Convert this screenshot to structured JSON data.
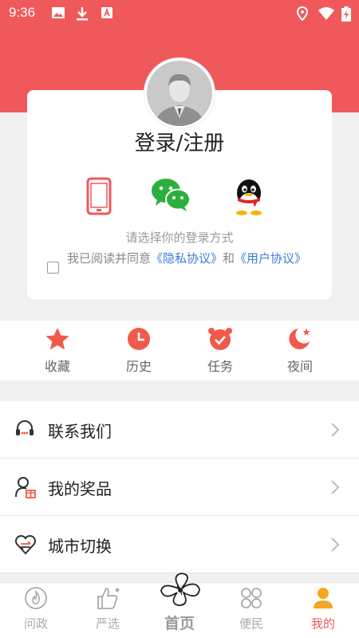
{
  "status_bar": {
    "time": "9:36"
  },
  "login": {
    "title": "登录/注册",
    "methods": [
      "phone-icon",
      "wechat-icon",
      "qq-icon"
    ],
    "tip": "请选择你的登录方式",
    "agree_prefix": "我已阅读并同意",
    "privacy_link": "《隐私协议》",
    "and": "和",
    "user_link": "《用户协议》"
  },
  "quick": [
    {
      "label": "收藏",
      "icon": "star-icon"
    },
    {
      "label": "历史",
      "icon": "clock-icon"
    },
    {
      "label": "任务",
      "icon": "alarm-icon"
    },
    {
      "label": "夜间",
      "icon": "moon-icon"
    }
  ],
  "menu": [
    {
      "label": "联系我们",
      "icon": "headset-icon"
    },
    {
      "label": "我的奖品",
      "icon": "gift-user-icon"
    },
    {
      "label": "城市切换",
      "icon": "city-switch-icon"
    }
  ],
  "tabs": [
    {
      "label": "问政"
    },
    {
      "label": "严选"
    },
    {
      "label": "首页"
    },
    {
      "label": "便民"
    },
    {
      "label": "我的"
    }
  ],
  "colors": {
    "accent": "#f0595b",
    "link": "#3a7bd5",
    "wechat": "#2bb03e"
  }
}
